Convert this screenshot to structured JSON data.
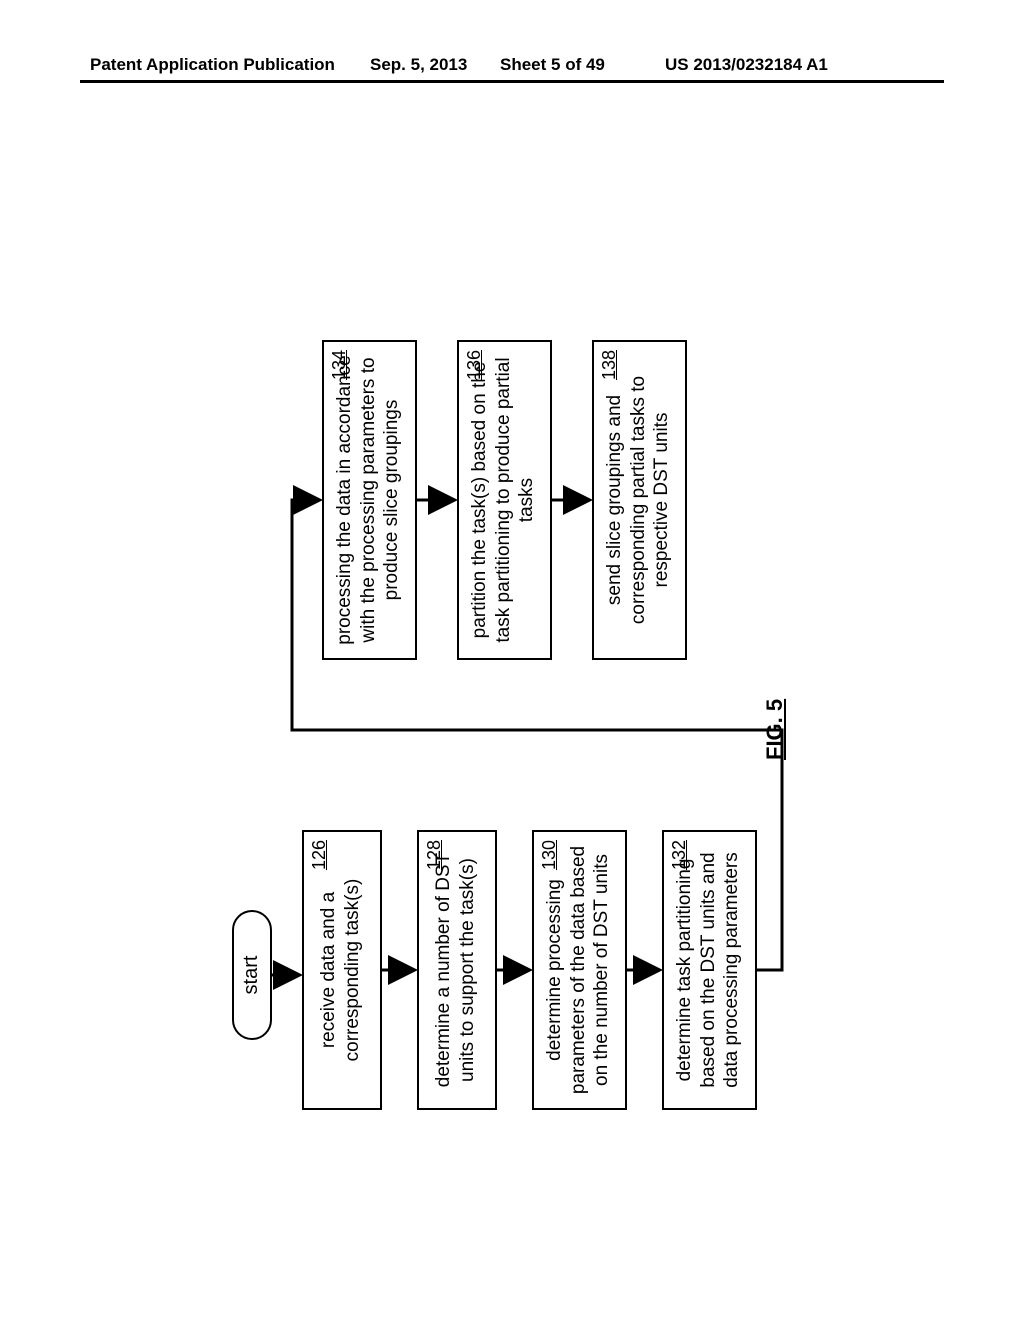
{
  "header": {
    "left": "Patent Application Publication",
    "date": "Sep. 5, 2013",
    "sheet": "Sheet 5 of 49",
    "pubno": "US 2013/0232184 A1"
  },
  "figure_label": "FIG. 5",
  "start": "start",
  "steps": {
    "s126": {
      "num": "126",
      "text": "receive data and a corresponding task(s)"
    },
    "s128": {
      "num": "128",
      "text": "determine a number of DST units to support the task(s)"
    },
    "s130": {
      "num": "130",
      "text": "determine processing parameters of the data based on the number of DST units"
    },
    "s132": {
      "num": "132",
      "text": "determine task partitioning based on the DST units and data processing parameters"
    },
    "s134": {
      "num": "134",
      "text": "processing the data in accordance with the processing parameters to produce slice groupings"
    },
    "s136": {
      "num": "136",
      "text": "partition the task(s) based on the task partitioning to produce partial tasks"
    },
    "s138": {
      "num": "138",
      "text": "send slice groupings and corresponding partial tasks to respective DST units"
    }
  }
}
